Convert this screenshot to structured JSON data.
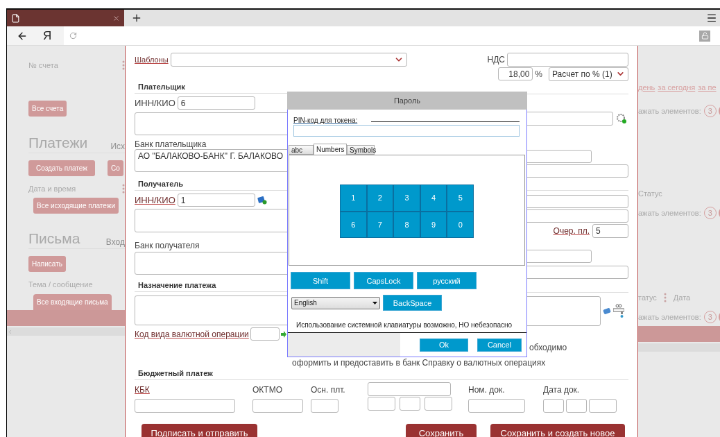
{
  "browser": {
    "logo": "Я"
  },
  "sidebar": {
    "account_column": "№ счета",
    "accounts_button": "Все счета",
    "sections": [
      {
        "heading": "Платежи",
        "tab": "Исх",
        "buttons": [
          "Создать платеж",
          "Со"
        ],
        "column": "Дата и время",
        "all_button": "Все исходящие платежи"
      },
      {
        "heading": "Письма",
        "tab": "Вход",
        "buttons": [
          "Написать"
        ],
        "column": "Тема / сообщение",
        "all_button": "Все входящие письма"
      }
    ]
  },
  "form": {
    "templates_label": "Шаблоны",
    "vat": {
      "label": "НДС",
      "rate": "18,00",
      "unit": "%",
      "mode": "Расчет по % (1)"
    },
    "parties": [
      {
        "title": "Плательщик",
        "inn_label": "ИНН/КИО",
        "inn_link": false,
        "inn": "6",
        "bank_label": "Банк плательщика",
        "bank": "АО \"БАЛАКОВО-БАНК\" Г. БАЛАКОВО"
      },
      {
        "title": "Получатель",
        "inn_label": "ИНН/КИО",
        "inn_link": true,
        "inn": "1",
        "bank_label": "Банк получателя"
      }
    ],
    "queue": {
      "label": "Очер. пл.",
      "value": "5"
    },
    "purpose_title": "Назначение платежа",
    "currency": {
      "label": "Код вида валютной операции",
      "note_end": "обходимо",
      "note": "оформить и предоставить в банк Справку о валютных операциях"
    },
    "budget": {
      "title": "Бюджетный платеж",
      "fields": [
        {
          "label": "КБК",
          "link": true
        },
        {
          "label": "ОКТМО",
          "link": false
        },
        {
          "label": "Осн. плт.",
          "link": false
        },
        {
          "label": "Ном. док.",
          "link": false
        },
        {
          "label": "Дата док.",
          "link": false
        }
      ]
    },
    "actions": [
      "Подписать и отправить",
      "Сохранить",
      "Сохранить и создать новое"
    ]
  },
  "right_panel": {
    "period_links": [
      "день",
      "за сегодня",
      "за пе"
    ],
    "groups": [
      {
        "show_label": "ажать элементов:",
        "count": "3"
      },
      {
        "columns": [
          "Статус"
        ],
        "show_label": "ажать элементов:",
        "count": "3"
      },
      {
        "columns": [
          "татус",
          "Дата"
        ],
        "show_label": "ажать элементов:",
        "count": "3"
      }
    ]
  },
  "modal": {
    "title": "Пароль",
    "pin_label": "PIN-код для токена:",
    "tabs": [
      {
        "label": "abc",
        "selected": false
      },
      {
        "label": "Numbers",
        "selected": true
      },
      {
        "label": "Symbols",
        "selected": false
      }
    ],
    "keys": [
      "1",
      "2",
      "3",
      "4",
      "5",
      "6",
      "7",
      "8",
      "9",
      "0"
    ],
    "mode_buttons": [
      "Shift",
      "CapsLock",
      "русский"
    ],
    "layout": "English",
    "backspace": "BackSpace",
    "warning": "Использование системной клавиатуры возможно, НО небезопасно",
    "ok": "Ok",
    "cancel": "Cancel"
  }
}
